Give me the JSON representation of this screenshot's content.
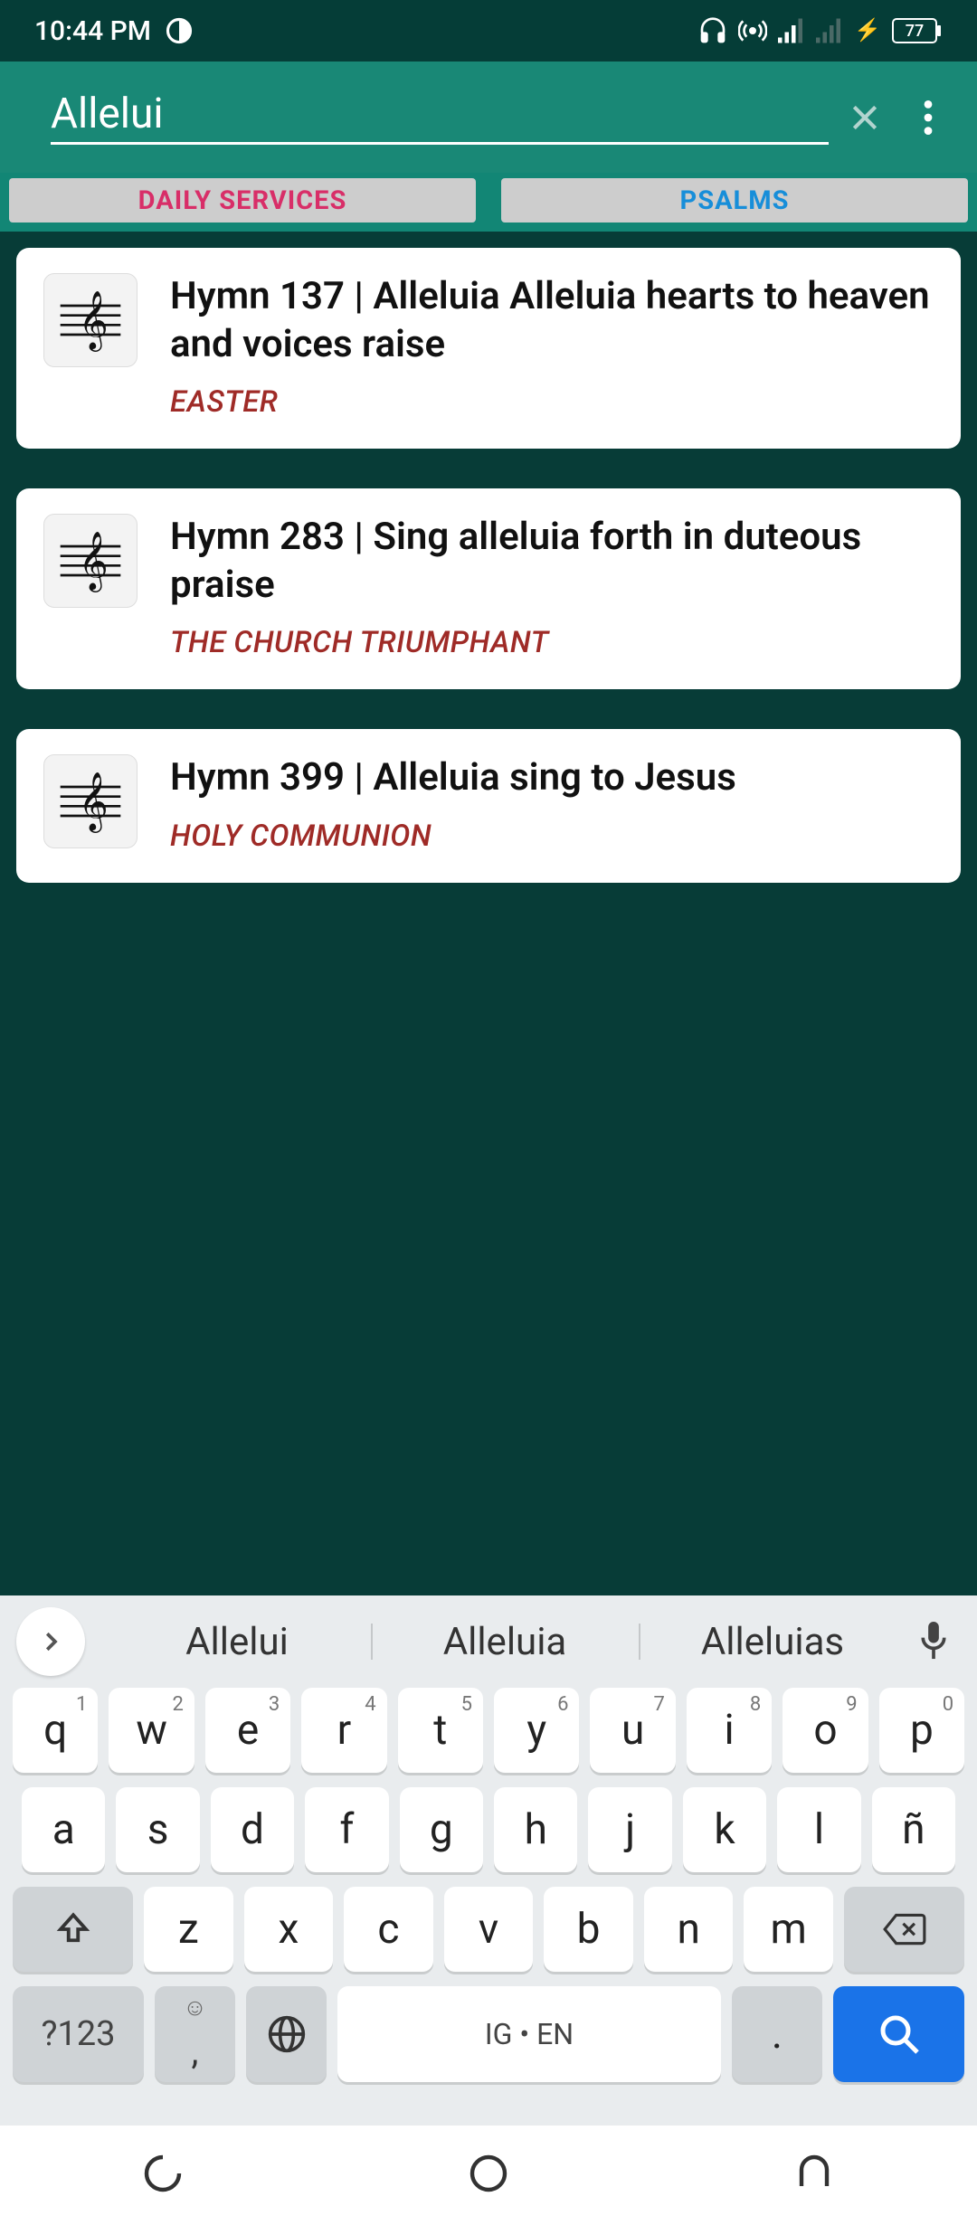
{
  "status": {
    "time": "10:44 PM",
    "battery": "77"
  },
  "search": {
    "value": "Allelui"
  },
  "tabs": {
    "daily": "DAILY SERVICES",
    "psalms": "PSALMS"
  },
  "results": [
    {
      "title": "Hymn 137 | Alleluia Alleluia hearts to heaven and voices raise",
      "category": "EASTER"
    },
    {
      "title": "Hymn 283 |  Sing alleluia forth in duteous praise",
      "category": "THE CHURCH TRIUMPHANT"
    },
    {
      "title": "Hymn 399 | Alleluia sing to Jesus",
      "category": "HOLY COMMUNION"
    }
  ],
  "keyboard": {
    "suggestions": [
      "Allelui",
      "Alleluia",
      "Alleluias"
    ],
    "row1": [
      {
        "k": "q",
        "s": "1"
      },
      {
        "k": "w",
        "s": "2"
      },
      {
        "k": "e",
        "s": "3"
      },
      {
        "k": "r",
        "s": "4"
      },
      {
        "k": "t",
        "s": "5"
      },
      {
        "k": "y",
        "s": "6"
      },
      {
        "k": "u",
        "s": "7"
      },
      {
        "k": "i",
        "s": "8"
      },
      {
        "k": "o",
        "s": "9"
      },
      {
        "k": "p",
        "s": "0"
      }
    ],
    "row2": [
      "a",
      "s",
      "d",
      "f",
      "g",
      "h",
      "j",
      "k",
      "l",
      "ñ"
    ],
    "row3": [
      "z",
      "x",
      "c",
      "v",
      "b",
      "n",
      "m"
    ],
    "symnum": "?123",
    "space": "IG • EN",
    "period": "."
  }
}
